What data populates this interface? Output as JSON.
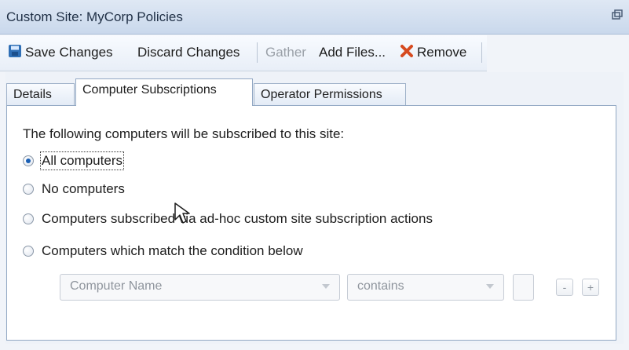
{
  "window": {
    "title": "Custom Site: MyCorp Policies",
    "restore_icon": "restore-window-icon"
  },
  "toolbar": {
    "save_label": "Save Changes",
    "discard_label": "Discard Changes",
    "gather_label": "Gather",
    "add_files_label": "Add Files...",
    "remove_label": "Remove",
    "icons": {
      "save": "save-icon",
      "remove": "remove-icon"
    },
    "colors": {
      "remove_icon": "#d64a1f",
      "save_icon": "#2f6fb6"
    }
  },
  "tabs": [
    {
      "label": "Details"
    },
    {
      "label": "Computer Subscriptions"
    },
    {
      "label": "Operator Permissions"
    }
  ],
  "subscription": {
    "intro": "The following computers will be subscribed to this site:",
    "options": [
      {
        "label": "All computers",
        "selected": true
      },
      {
        "label": "No computers",
        "selected": false
      },
      {
        "label": "Computers subscribed via ad-hoc custom site subscription actions",
        "selected": false
      },
      {
        "label": "Computers which match the condition below",
        "selected": false
      }
    ],
    "condition": {
      "field": "Computer Name",
      "operator": "contains",
      "value": "",
      "minus_label": "-",
      "plus_label": "+"
    }
  }
}
